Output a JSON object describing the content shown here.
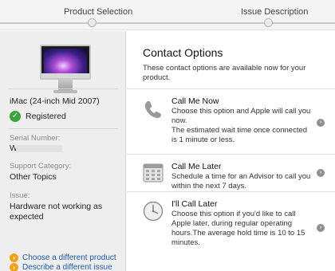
{
  "progress": {
    "steps": [
      {
        "label": "Product Selection"
      },
      {
        "label": "Issue Description"
      }
    ]
  },
  "sidebar": {
    "product_name": "iMac (24-inch Mid 2007)",
    "registration_status": "Registered",
    "serial_label": "Serial Number:",
    "serial_value": "W",
    "support_category_label": "Support Category:",
    "support_category_value": "Other Topics",
    "issue_label": "Issue:",
    "issue_value": "Hardware not working as expected",
    "links": [
      {
        "label": "Choose a different product"
      },
      {
        "label": "Describe a different issue"
      }
    ]
  },
  "main": {
    "title": "Contact Options",
    "intro": "These contact options are available now for your product.",
    "options": [
      {
        "title": "Call Me Now",
        "description": "Choose this option and Apple will call you now.\nThe estimated wait time once connected is 1 minute or less.",
        "icon": "phone-icon"
      },
      {
        "title": "Call Me Later",
        "description": "Schedule a time for an Advisor to call you within the next 7 days.",
        "icon": "calendar-icon"
      },
      {
        "title": "I'll Call Later",
        "description": "Choose this option if you'd like to call Apple later, during regular operating hours.The average hold time is 10 to 15 minutes.",
        "icon": "clock-icon"
      }
    ]
  },
  "colors": {
    "link": "#1f5aa8",
    "registered_check": "#3aa33a",
    "link_arrow": "#f0a21a",
    "sidebar_bg": "#eeeeee"
  }
}
